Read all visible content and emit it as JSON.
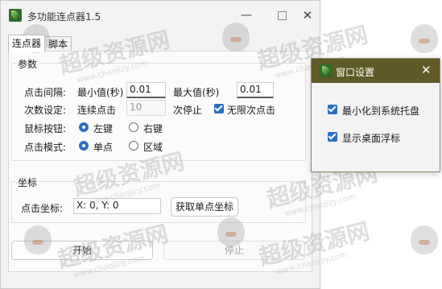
{
  "main_window": {
    "title": "多功能连点器1.5",
    "controls": {
      "minimize": "—",
      "close": "✕"
    },
    "tabs": [
      {
        "label": "连点器"
      },
      {
        "label": "脚本"
      }
    ],
    "params": {
      "group_title": "参数",
      "interval": {
        "label": "点击间隔:",
        "min_label": "最小值(秒)",
        "min_value": "0.01",
        "max_label": "最大值(秒)",
        "max_value": "0.01"
      },
      "count": {
        "label": "次数设定:",
        "prefix": "连续点击",
        "value": "10",
        "suffix": "次停止",
        "infinite_label": "无限次点击",
        "infinite_checked": true
      },
      "mouse_button": {
        "label": "鼠标按钮:",
        "options": [
          {
            "label": "左键",
            "selected": true
          },
          {
            "label": "右键",
            "selected": false
          }
        ]
      },
      "click_mode": {
        "label": "点击模式:",
        "options": [
          {
            "label": "单点",
            "selected": true
          },
          {
            "label": "区域",
            "selected": false
          }
        ]
      }
    },
    "coords": {
      "group_title": "坐标",
      "label": "点击坐标:",
      "value": "X: 0, Y: 0",
      "get_button": "获取单点坐标"
    },
    "start_button": "开始",
    "stop_button": "停止"
  },
  "settings_window": {
    "title": "窗口设置",
    "close": "✕",
    "options": [
      {
        "label": "最小化到系统托盘",
        "checked": true
      },
      {
        "label": "显示桌面浮标",
        "checked": true
      }
    ]
  },
  "watermark": {
    "text": "超级资源网",
    "url": "www.chaojizy.com"
  },
  "colors": {
    "accent": "#2a6fc4",
    "settings_titlebar": "#5f5a26"
  }
}
